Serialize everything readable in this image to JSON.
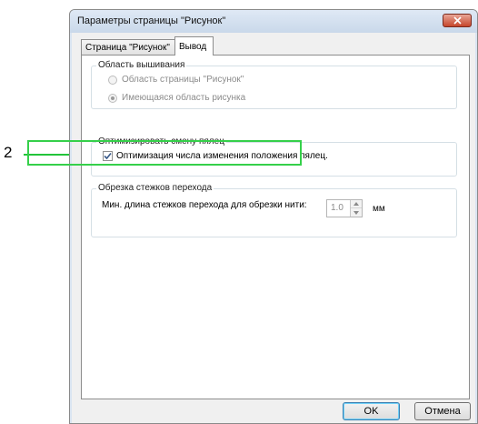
{
  "callout": {
    "number": "2"
  },
  "window": {
    "title": "Параметры страницы \"Рисунок\""
  },
  "tabs": [
    {
      "label": "Страница \"Рисунок\"",
      "active": false
    },
    {
      "label": "Вывод",
      "active": true
    }
  ],
  "embroidery_area": {
    "legend": "Область вышивания",
    "options": [
      {
        "label": "Область страницы \"Рисунок\"",
        "selected": false,
        "enabled": false
      },
      {
        "label": "Имеющаяся область рисунка",
        "selected": true,
        "enabled": false
      }
    ]
  },
  "optimize": {
    "legend": "Оптимизировать смену пялец",
    "checkbox_label": "Оптимизация числа изменения положения пялец.",
    "checked": true
  },
  "jump_trim": {
    "legend": "Обрезка стежков перехода",
    "min_length_label": "Мин. длина стежков перехода для обрезки нити:",
    "value": "1.0",
    "unit": "мм"
  },
  "buttons": {
    "ok": "OK",
    "cancel": "Отмена"
  },
  "colors": {
    "highlight": "#35d04a",
    "callout_line": "#22c43a",
    "close_button": "#c6452b"
  },
  "icons": {
    "close": "close-icon",
    "check": "checkmark-icon",
    "spin_up": "spin-up-icon",
    "spin_down": "spin-down-icon"
  }
}
